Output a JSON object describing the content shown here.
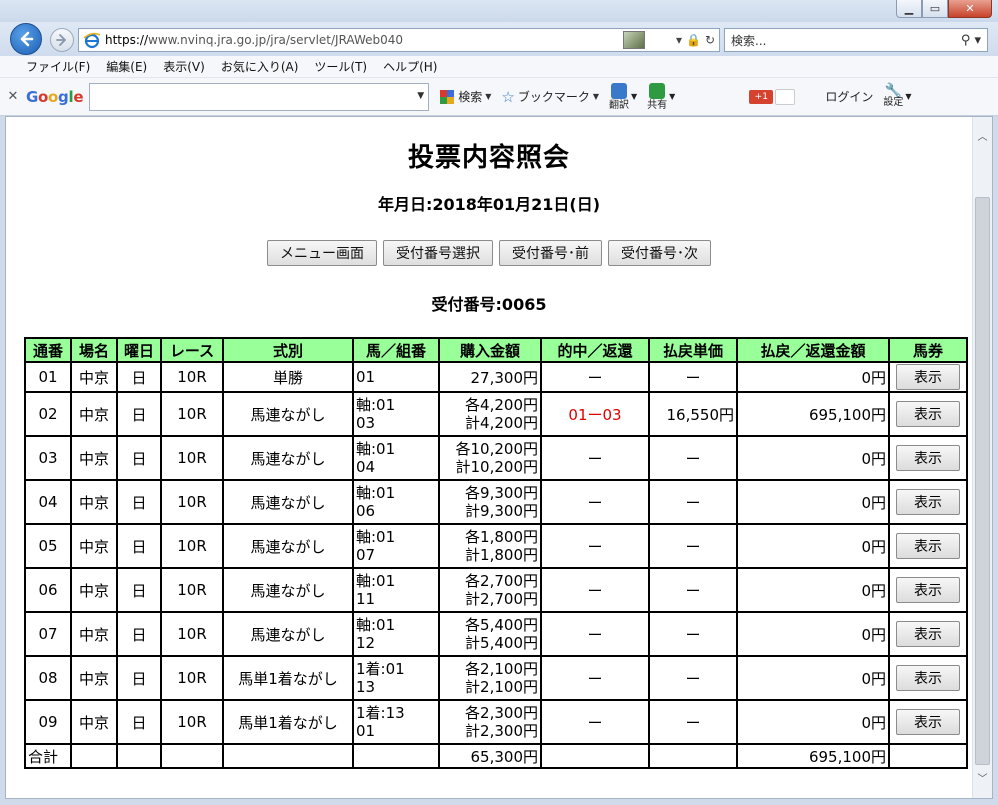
{
  "browser": {
    "url_scheme": "https://",
    "url_rest": "www.nvinq.jra.go.jp/jra/servlet/JRAWeb040",
    "search_placeholder": "検索...",
    "menu": [
      "ファイル(F)",
      "編集(E)",
      "表示(V)",
      "お気に入り(A)",
      "ツール(T)",
      "ヘルプ(H)"
    ],
    "google_toolbar": {
      "search_label": "検索",
      "bookmark_label": "ブックマーク",
      "translate_label": "翻訳",
      "share_label": "共有",
      "gplus_label": "+1",
      "login_label": "ログイン",
      "settings_label": "設定"
    }
  },
  "page": {
    "title": "投票内容照会",
    "date_label": "年月日:2018年01月21日(日)",
    "buttons": {
      "menu": "メニュー画面",
      "select": "受付番号選択",
      "prev": "受付番号･前",
      "next": "受付番号･次"
    },
    "receipt_label": "受付番号:0065"
  },
  "table": {
    "headers": [
      "通番",
      "場名",
      "曜日",
      "レース",
      "式別",
      "馬／組番",
      "購入金額",
      "的中／返還",
      "払戻単価",
      "払戻／返還金額",
      "馬券"
    ],
    "rows": [
      {
        "no": "01",
        "venue": "中京",
        "day": "日",
        "race": "10R",
        "type": "単勝",
        "horse1": "01",
        "horse2": "",
        "amt1": "27,300円",
        "amt2": "",
        "hit": "ー",
        "unit": "ー",
        "payout": "0円",
        "btn": "表示"
      },
      {
        "no": "02",
        "venue": "中京",
        "day": "日",
        "race": "10R",
        "type": "馬連ながし",
        "horse1": "軸:01",
        "horse2": "03",
        "amt1": "各4,200円",
        "amt2": "計4,200円",
        "hit": "01ー03",
        "unit": "16,550円",
        "payout": "695,100円",
        "btn": "表示"
      },
      {
        "no": "03",
        "venue": "中京",
        "day": "日",
        "race": "10R",
        "type": "馬連ながし",
        "horse1": "軸:01",
        "horse2": "04",
        "amt1": "各10,200円",
        "amt2": "計10,200円",
        "hit": "ー",
        "unit": "ー",
        "payout": "0円",
        "btn": "表示"
      },
      {
        "no": "04",
        "venue": "中京",
        "day": "日",
        "race": "10R",
        "type": "馬連ながし",
        "horse1": "軸:01",
        "horse2": "06",
        "amt1": "各9,300円",
        "amt2": "計9,300円",
        "hit": "ー",
        "unit": "ー",
        "payout": "0円",
        "btn": "表示"
      },
      {
        "no": "05",
        "venue": "中京",
        "day": "日",
        "race": "10R",
        "type": "馬連ながし",
        "horse1": "軸:01",
        "horse2": "07",
        "amt1": "各1,800円",
        "amt2": "計1,800円",
        "hit": "ー",
        "unit": "ー",
        "payout": "0円",
        "btn": "表示"
      },
      {
        "no": "06",
        "venue": "中京",
        "day": "日",
        "race": "10R",
        "type": "馬連ながし",
        "horse1": "軸:01",
        "horse2": "11",
        "amt1": "各2,700円",
        "amt2": "計2,700円",
        "hit": "ー",
        "unit": "ー",
        "payout": "0円",
        "btn": "表示"
      },
      {
        "no": "07",
        "venue": "中京",
        "day": "日",
        "race": "10R",
        "type": "馬連ながし",
        "horse1": "軸:01",
        "horse2": "12",
        "amt1": "各5,400円",
        "amt2": "計5,400円",
        "hit": "ー",
        "unit": "ー",
        "payout": "0円",
        "btn": "表示"
      },
      {
        "no": "08",
        "venue": "中京",
        "day": "日",
        "race": "10R",
        "type": "馬単1着ながし",
        "horse1": "1着:01",
        "horse2": "13",
        "amt1": "各2,100円",
        "amt2": "計2,100円",
        "hit": "ー",
        "unit": "ー",
        "payout": "0円",
        "btn": "表示"
      },
      {
        "no": "09",
        "venue": "中京",
        "day": "日",
        "race": "10R",
        "type": "馬単1着ながし",
        "horse1": "1着:13",
        "horse2": "01",
        "amt1": "各2,300円",
        "amt2": "計2,300円",
        "hit": "ー",
        "unit": "ー",
        "payout": "0円",
        "btn": "表示"
      }
    ],
    "total": {
      "label": "合計",
      "amount": "65,300円",
      "payout": "695,100円"
    }
  },
  "colors": {
    "header_bg": "#99ff99",
    "hit_text": "#e00000"
  }
}
